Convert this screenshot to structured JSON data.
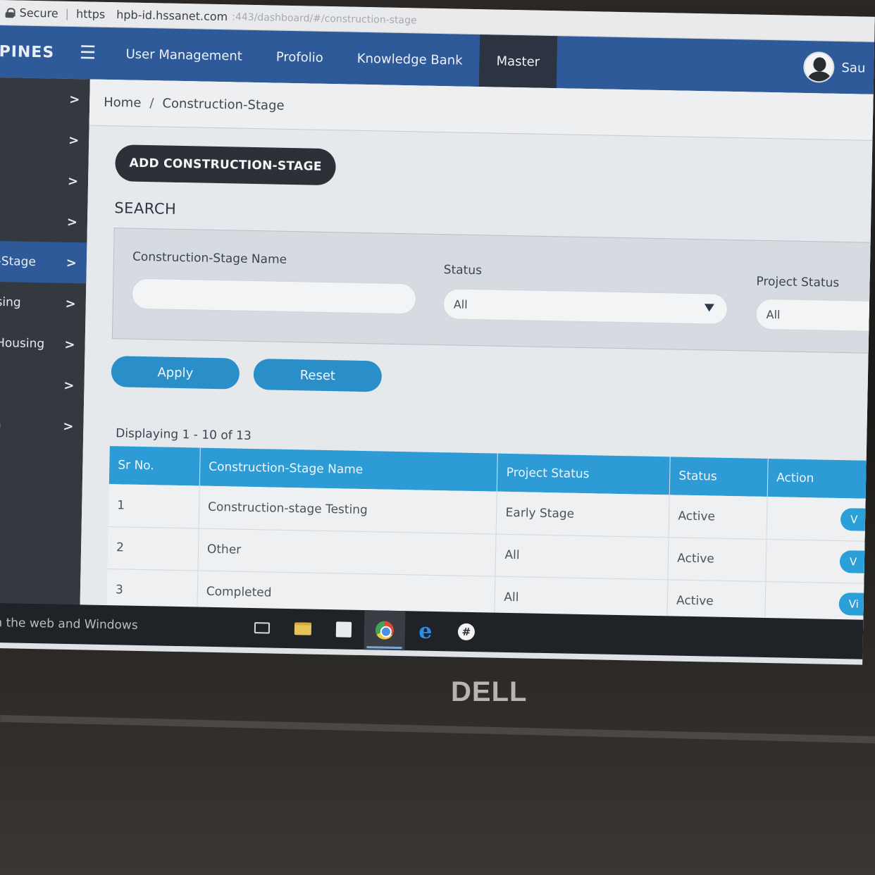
{
  "browser": {
    "secure_label": "Secure",
    "protocol": "https",
    "host": "hpb-id.hssanet.com",
    "path": ":443/dashboard/#/construction-stage"
  },
  "topnav": {
    "brand": "PINES",
    "items": [
      {
        "label": "User Management"
      },
      {
        "label": "Profolio"
      },
      {
        "label": "Knowledge Bank"
      },
      {
        "label": "Master",
        "active": true
      }
    ],
    "user_name": "Sau"
  },
  "sidebar": {
    "items": [
      {
        "label": ""
      },
      {
        "label": ""
      },
      {
        "label": "/"
      },
      {
        "label": ""
      },
      {
        "label": "n-Stage",
        "active": true
      },
      {
        "label": "using"
      },
      {
        "label": "f Housing"
      },
      {
        "label": ""
      },
      {
        "label": "on"
      }
    ]
  },
  "breadcrumb": {
    "home": "Home",
    "separator": "/",
    "current": "Construction-Stage"
  },
  "actions": {
    "add_label": "ADD CONSTRUCTION-STAGE"
  },
  "search": {
    "title": "SEARCH",
    "name_label": "Construction-Stage Name",
    "name_value": "",
    "status_label": "Status",
    "status_value": "All",
    "project_status_label": "Project Status",
    "project_status_value": "All",
    "apply_label": "Apply",
    "reset_label": "Reset"
  },
  "results": {
    "display_text": "Displaying 1 - 10 of 13"
  },
  "table": {
    "headers": [
      "Sr No.",
      "Construction-Stage Name",
      "Project Status",
      "Status",
      "Action"
    ],
    "rows": [
      {
        "sr": "1",
        "name": "Construction-stage Testing",
        "project_status": "Early Stage",
        "status": "Active",
        "action": "V"
      },
      {
        "sr": "2",
        "name": "Other",
        "project_status": "All",
        "status": "Active",
        "action": "V"
      },
      {
        "sr": "3",
        "name": "Completed",
        "project_status": "All",
        "status": "Active",
        "action": "Vi"
      }
    ]
  },
  "taskbar": {
    "search_hint": "ch the web and Windows"
  },
  "bezel": {
    "logo": "DELL"
  },
  "colors": {
    "nav": "#2e5a9a",
    "sidebar": "#34383f",
    "table_header": "#2d9bd6",
    "button": "#2a8ec9"
  }
}
